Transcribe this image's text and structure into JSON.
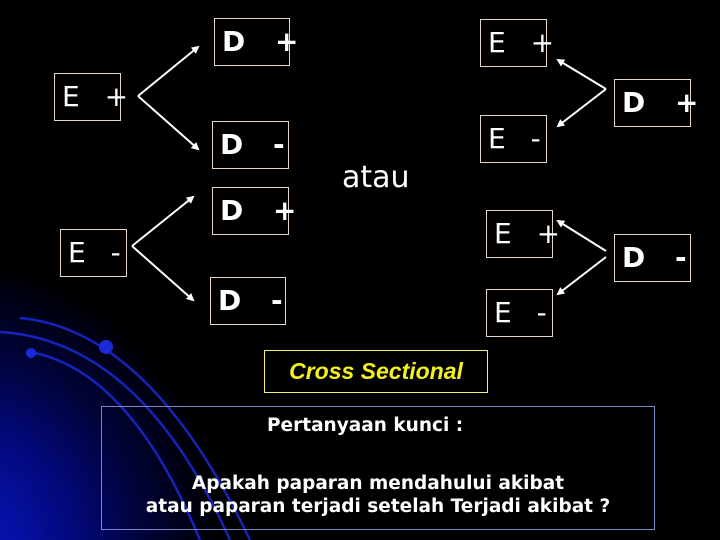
{
  "diagram": {
    "left_group": {
      "exposure_positive": "E +",
      "outcome_from_e_pos_top": "D +",
      "outcome_from_e_pos_bottom": "D -",
      "exposure_negative": "E -",
      "outcome_from_e_neg_top": "D +",
      "outcome_from_e_neg_bottom": "D -"
    },
    "connector_text": "atau",
    "right_group": {
      "disease_positive": "D +",
      "exposure_from_d_pos_top": "E +",
      "exposure_from_d_pos_bottom": "E -",
      "disease_negative": "D -",
      "exposure_from_d_neg_top": "E +",
      "exposure_from_d_neg_bottom": "E -"
    },
    "arrow_icon": "arrow-icon"
  },
  "label": {
    "study_type": "Cross Sectional"
  },
  "question_box": {
    "title": "Pertanyaan kunci :",
    "line1": "Apakah paparan mendahului akibat",
    "line2": "atau paparan terjadi setelah Terjadi akibat ?"
  },
  "colors": {
    "background": "#000000",
    "box_border": "#e6d5c6",
    "highlight_text": "#f4f21c",
    "highlight_border": "#f2ef6a",
    "question_border": "#7a86c8",
    "deco_blue": "#0a14c8"
  }
}
